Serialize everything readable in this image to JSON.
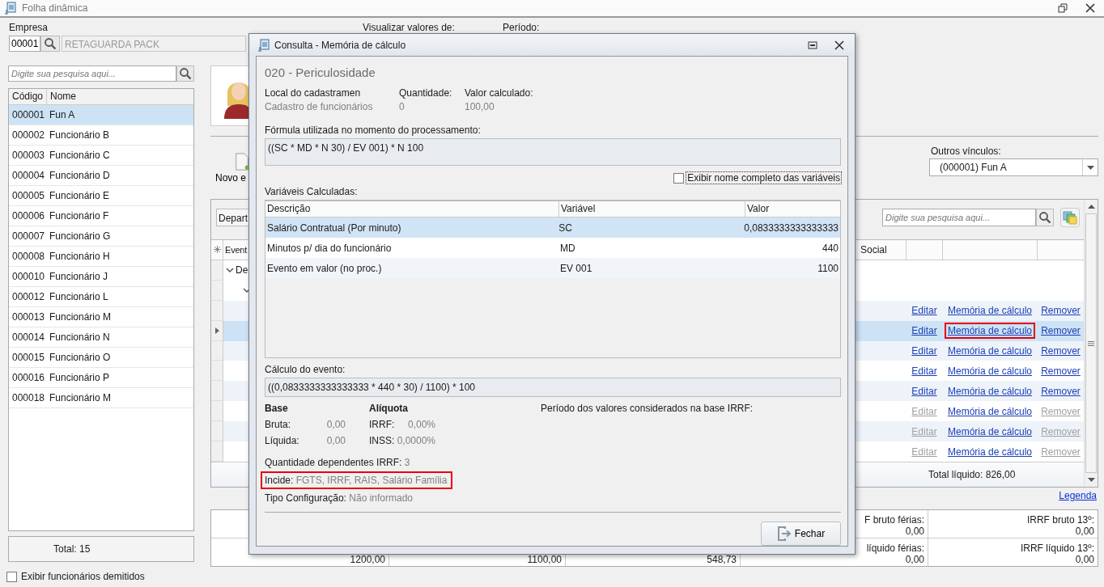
{
  "window": {
    "title": "Folha dinâmica"
  },
  "company": {
    "label": "Empresa",
    "code": "00001",
    "name": "RETAGUARDA PACK"
  },
  "view_label": "Visualizar valores de:",
  "period_label": "Período:",
  "employees": {
    "search_placeholder": "Digite sua pesquisa aqui...",
    "columns": [
      "Código",
      "Nome"
    ],
    "rows": [
      {
        "code": "000001",
        "name": "Fun A",
        "selected": true
      },
      {
        "code": "000002",
        "name": "Funcionário B",
        "selected": false
      },
      {
        "code": "000003",
        "name": "Funcionário C",
        "selected": false
      },
      {
        "code": "000004",
        "name": "Funcionário D",
        "selected": false
      },
      {
        "code": "000005",
        "name": "Funcionário E",
        "selected": false
      },
      {
        "code": "000006",
        "name": "Funcionário F",
        "selected": false
      },
      {
        "code": "000007",
        "name": "Funcionário G",
        "selected": false
      },
      {
        "code": "000008",
        "name": "Funcionário H",
        "selected": false
      },
      {
        "code": "000010",
        "name": "Funcionário J",
        "selected": false
      },
      {
        "code": "000012",
        "name": "Funcionário L",
        "selected": false
      },
      {
        "code": "000013",
        "name": "Funcionário M",
        "selected": false
      },
      {
        "code": "000014",
        "name": "Funcionário N",
        "selected": false
      },
      {
        "code": "000015",
        "name": "Funcionário O",
        "selected": false
      },
      {
        "code": "000016",
        "name": "Funcionário P",
        "selected": false
      },
      {
        "code": "000018",
        "name": "Funcionário M",
        "selected": false
      }
    ],
    "total": "Total: 15",
    "show_dismissed": {
      "label": "Exibir funcionários demitidos",
      "checked": false
    }
  },
  "new_event_button": "Novo e",
  "other_links": {
    "label": "Outros vínculos:",
    "value": "(000001) Fun A"
  },
  "events": {
    "department_field": "Depart",
    "search_placeholder": "Digite sua pesquisa aqui...",
    "column_headers": [
      "Event",
      "Social"
    ],
    "tree": [
      {
        "label": "De",
        "expanded": true,
        "children": [
          {
            "expanded": true
          }
        ]
      }
    ],
    "rows": [
      {
        "selected": false,
        "highlighted": false,
        "edit": "Editar",
        "edit_enabled": true,
        "memory": "Memória de cálculo",
        "remove": "Remover",
        "remove_enabled": true
      },
      {
        "selected": true,
        "highlighted": true,
        "edit": "Editar",
        "edit_enabled": true,
        "memory": "Memória de cálculo",
        "remove": "Remover",
        "remove_enabled": true
      },
      {
        "selected": false,
        "highlighted": false,
        "edit": "Editar",
        "edit_enabled": true,
        "memory": "Memória de cálculo",
        "remove": "Remover",
        "remove_enabled": true
      },
      {
        "selected": false,
        "highlighted": false,
        "edit": "Editar",
        "edit_enabled": true,
        "memory": "Memória de cálculo",
        "remove": "Remover",
        "remove_enabled": true
      },
      {
        "selected": false,
        "highlighted": false,
        "edit": "Editar",
        "edit_enabled": true,
        "memory": "Memória de cálculo",
        "remove": "Remover",
        "remove_enabled": true
      },
      {
        "selected": false,
        "highlighted": false,
        "edit": "Editar",
        "edit_enabled": false,
        "memory": "Memória de cálculo",
        "remove": "Remover",
        "remove_enabled": false
      },
      {
        "selected": false,
        "highlighted": false,
        "edit": "Editar",
        "edit_enabled": false,
        "memory": "Memória de cálculo",
        "remove": "Remover",
        "remove_enabled": false
      },
      {
        "selected": false,
        "highlighted": false,
        "edit": "Editar",
        "edit_enabled": false,
        "memory": "Memória de cálculo",
        "remove": "Remover",
        "remove_enabled": false
      }
    ],
    "total": "Total líquido: 826,00"
  },
  "legend_link": "Legenda",
  "summary": [
    {
      "cells": [
        {
          "label": "F bruto férias:",
          "value": "0,00"
        },
        {
          "label": "IRRF bruto 13º:",
          "value": "0,00"
        }
      ]
    },
    {
      "cells": [
        {
          "value": "1200,00"
        },
        {
          "value": "1100,00"
        },
        {
          "value": "548,73"
        },
        {
          "label": "líquido férias:",
          "value": "0,00"
        },
        {
          "label": "IRRF líquido 13º:",
          "value": "0,00"
        }
      ]
    }
  ],
  "dialog": {
    "title": "Consulta - Memória de cálculo",
    "heading": "020 - Periculosidade",
    "fields": [
      {
        "label": "Local do cadastramen",
        "value": "Cadastro de funcionários"
      },
      {
        "label": "Quantidade:",
        "value": "0"
      },
      {
        "label": "Valor calculado:",
        "value": "100,00"
      }
    ],
    "formula_label": "Fórmula utilizada no momento do processamento:",
    "formula": "((SC * MD * N 30) / EV 001) * N 100",
    "show_full_names": {
      "label": "Exibir nome completo das variáveis",
      "checked": false
    },
    "variables_label": "Variáveis Calculadas:",
    "variables": {
      "columns": [
        "Descrição",
        "Variável",
        "Valor"
      ],
      "rows": [
        {
          "description": "Salário Contratual (Por minuto)",
          "variable": "SC",
          "value": "0,0833333333333333",
          "selected": true
        },
        {
          "description": "Minutos p/ dia do funcionário",
          "variable": "MD",
          "value": "440",
          "selected": false
        },
        {
          "description": "Evento em valor (no proc.)",
          "variable": "EV 001",
          "value": "1100",
          "selected": false
        }
      ]
    },
    "calc_label": "Cálculo do evento:",
    "calc": "((0,0833333333333333 * 440 * 30) / 1100) * 100",
    "base_label": "Base",
    "rate_label": "Alíquota",
    "period_label": "Período dos valores considerados na base IRRF:",
    "base_rows": [
      {
        "label": "Bruta:",
        "value": "0,00",
        "rate_label": "IRRF:",
        "rate": "0,00%"
      },
      {
        "label": "Líquida:",
        "value": "0,00",
        "rate_label": "INSS:",
        "rate": "0,0000%"
      }
    ],
    "info": [
      {
        "label": "Quantidade dependentes IRRF:",
        "value": "3",
        "highlighted": false
      },
      {
        "label": "Incide:",
        "value": "FGTS, IRRF, RAIS, Salário Família",
        "highlighted": true
      },
      {
        "label": "Tipo Configuração:",
        "value": "Não informado",
        "highlighted": false
      }
    ],
    "close_button": "Fechar"
  }
}
